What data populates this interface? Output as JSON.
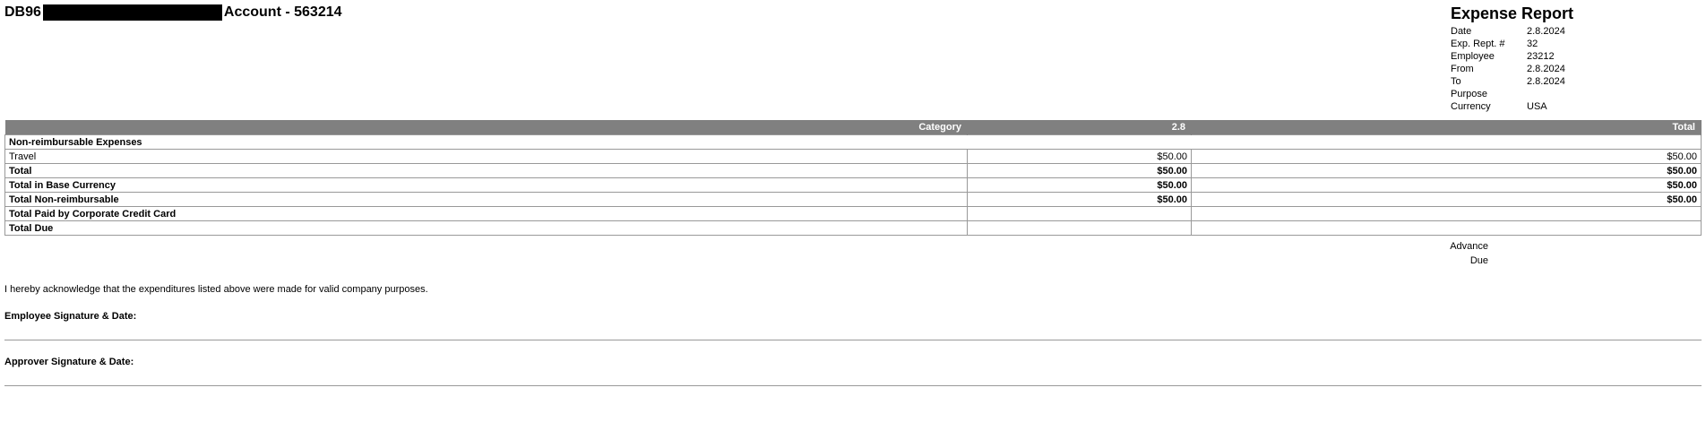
{
  "header": {
    "prefix": "DB96",
    "suffix": "Account - 563214",
    "report_title": "Expense Report",
    "meta": {
      "date_label": "Date",
      "date": "2.8.2024",
      "rept_label": "Exp. Rept. #",
      "rept": "32",
      "employee_label": "Employee",
      "employee": "23212",
      "from_label": "From",
      "from": "2.8.2024",
      "to_label": "To",
      "to": "2.8.2024",
      "purpose_label": "Purpose",
      "purpose": "",
      "currency_label": "Currency",
      "currency": "USA"
    }
  },
  "columns": {
    "category": "Category",
    "date": "2.8",
    "total": "Total"
  },
  "rows": {
    "section": "Non-reimbursable Expenses",
    "travel": {
      "label": "Travel",
      "date": "$50.00",
      "total": "$50.00"
    },
    "total": {
      "label": "Total",
      "date": "$50.00",
      "total": "$50.00"
    },
    "base": {
      "label": "Total in Base Currency",
      "date": "$50.00",
      "total": "$50.00"
    },
    "nonreimb": {
      "label": "Total Non-reimbursable",
      "date": "$50.00",
      "total": "$50.00"
    },
    "corpcard": {
      "label": "Total Paid by Corporate Credit Card",
      "date": "",
      "total": ""
    },
    "due": {
      "label": "Total Due",
      "date": "",
      "total": ""
    }
  },
  "footer": {
    "advance": "Advance",
    "due": "Due",
    "ack": "I hereby acknowledge that the expenditures listed above were made for valid company purposes.",
    "emp_sig": "Employee Signature & Date:",
    "app_sig": "Approver Signature & Date:"
  }
}
